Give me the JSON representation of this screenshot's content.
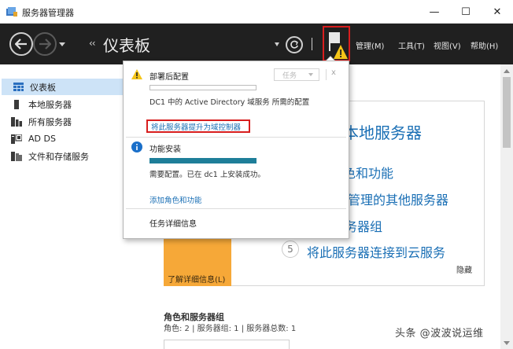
{
  "window": {
    "title": "服务器管理器",
    "minimize": "—",
    "maximize": "☐",
    "close": "✕"
  },
  "header": {
    "breadcrumb_title": "仪表板",
    "breadcrumb_arrows": "‹‹",
    "menus": [
      "管理(M)",
      "工具(T)",
      "视图(V)",
      "帮助(H)"
    ]
  },
  "sidebar": {
    "items": [
      {
        "label": "仪表板",
        "selected": true,
        "icon": "dashboard-icon"
      },
      {
        "label": "本地服务器",
        "selected": false,
        "icon": "local-server-icon"
      },
      {
        "label": "所有服务器",
        "selected": false,
        "icon": "all-servers-icon"
      },
      {
        "label": "AD DS",
        "selected": false,
        "icon": "ad-ds-icon"
      },
      {
        "label": "文件和存储服务",
        "selected": false,
        "icon": "file-storage-icon"
      }
    ]
  },
  "notifications": {
    "post_deploy": {
      "title": "部署后配置",
      "task_dropdown": "任务",
      "close": "x",
      "description": "DC1 中的 Active Directory 域服务 所需的配置",
      "action_link": "将此服务器提升为域控制器",
      "progress": 0
    },
    "feature_install": {
      "title": "功能安装",
      "description": "需要配置。已在 dc1 上安装成功。",
      "action_link": "添加角色和功能",
      "progress": 1
    },
    "task_details": "任务详细信息"
  },
  "welcome": {
    "heading_partial": "本地服务器",
    "link2_partial": "色和功能",
    "link3_partial": "管理的其他服务器",
    "link4_partial": "务器组",
    "step5_number": "5",
    "step5_text": "将此服务器连接到云服务",
    "learn_more": "了解详细信息(L)",
    "hide": "隐藏"
  },
  "roles_section": {
    "title": "角色和服务器组",
    "summary": "角色: 2 | 服务器组: 1 | 服务器总数: 1"
  },
  "watermark": "头条 @波波说运维",
  "colors": {
    "header_bg": "#202020",
    "selected_bg": "#cde3f7",
    "link": "#1a6fb5",
    "highlight_border": "#d81e1e",
    "orange_tile": "#f6a838",
    "progress_fill": "#1e7e99"
  }
}
